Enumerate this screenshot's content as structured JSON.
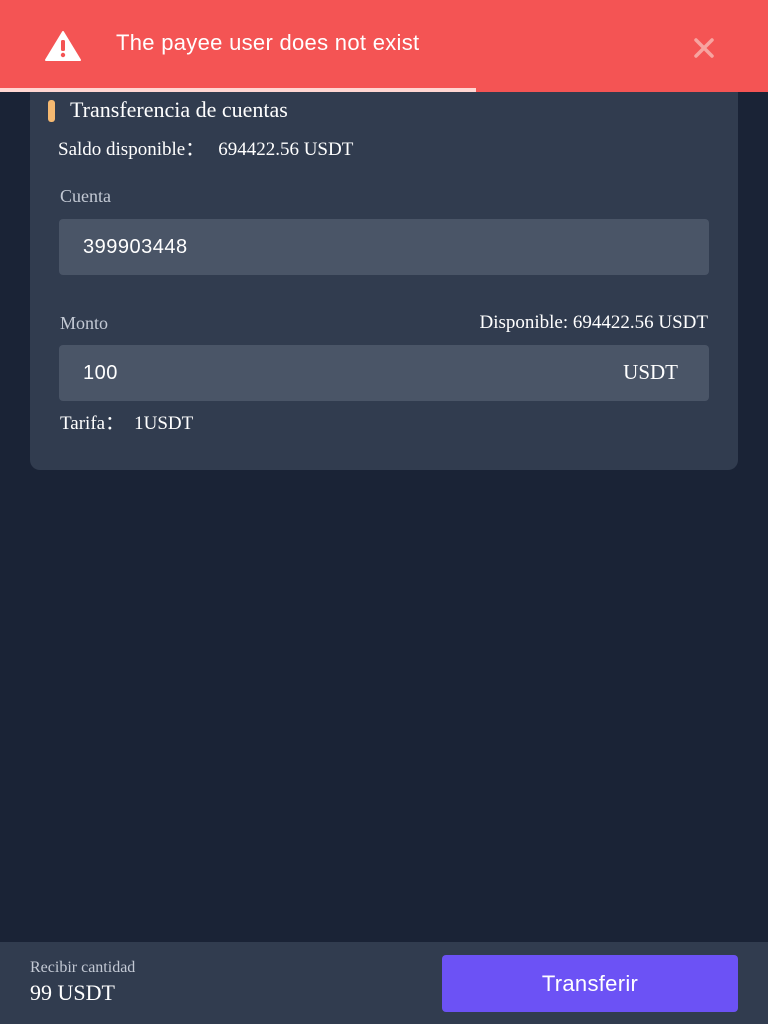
{
  "toast": {
    "message": "The payee user does not exist",
    "type": "error",
    "icon": "warning-icon",
    "close_icon": "close-icon",
    "color": "#f45454",
    "progress_fraction": 0.62
  },
  "card": {
    "title": "Transferencia de cuentas",
    "accent_color": "#f5b971",
    "balance": {
      "label": "Saldo disponible：",
      "value": "694422.56 USDT"
    },
    "account": {
      "label": "Cuenta",
      "value": "399903448"
    },
    "amount": {
      "label": "Monto",
      "available": "Disponible: 694422.56 USDT",
      "value": "100",
      "unit": "USDT"
    },
    "fee": {
      "label": "Tarifa：",
      "value": "1USDT"
    }
  },
  "footer": {
    "receive_label": "Recibir cantidad",
    "receive_value": "99 USDT",
    "transfer_button": "Transferir",
    "button_color": "#6c52f5"
  }
}
